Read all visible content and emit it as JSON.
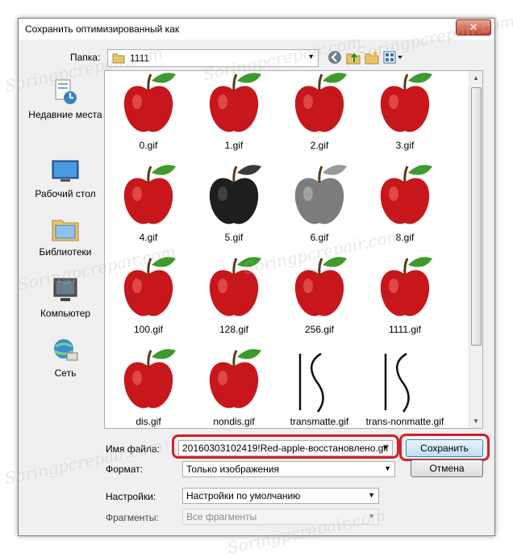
{
  "window": {
    "title": "Сохранить оптимизированный как",
    "close_glyph": "✕"
  },
  "toolbar": {
    "folder_label": "Папка:",
    "folder_value": "1111"
  },
  "places": [
    {
      "label": "Недавние места",
      "icon": "recent-places-icon"
    },
    {
      "label": "Рабочий стол",
      "icon": "desktop-icon"
    },
    {
      "label": "Библиотеки",
      "icon": "libraries-icon"
    },
    {
      "label": "Компьютер",
      "icon": "computer-icon"
    },
    {
      "label": "Сеть",
      "icon": "network-icon"
    }
  ],
  "files": [
    {
      "name": "0.gif",
      "kind": "apple"
    },
    {
      "name": "1.gif",
      "kind": "apple"
    },
    {
      "name": "2.gif",
      "kind": "apple"
    },
    {
      "name": "3.gif",
      "kind": "apple"
    },
    {
      "name": "4.gif",
      "kind": "apple"
    },
    {
      "name": "5.gif",
      "kind": "apple-dark"
    },
    {
      "name": "6.gif",
      "kind": "apple-gray"
    },
    {
      "name": "8.gif",
      "kind": "apple"
    },
    {
      "name": "100.gif",
      "kind": "apple"
    },
    {
      "name": "128.gif",
      "kind": "apple"
    },
    {
      "name": "256.gif",
      "kind": "apple"
    },
    {
      "name": "1111.gif",
      "kind": "apple"
    },
    {
      "name": "dis.gif",
      "kind": "apple"
    },
    {
      "name": "nondis.gif",
      "kind": "apple"
    },
    {
      "name": "transmatte.gif",
      "kind": "curve"
    },
    {
      "name": "trans-nonmatte.gif",
      "kind": "curve"
    }
  ],
  "form": {
    "filename_label": "Имя файла:",
    "filename_value": "20160303102419!Red-apple-восстановлено.gif",
    "format_label": "Формат:",
    "format_value": "Только изображения",
    "settings_label": "Настройки:",
    "settings_value": "Настройки по умолчанию",
    "fragments_label": "Фрагменты:",
    "fragments_value": "Все фрагменты"
  },
  "buttons": {
    "save": "Сохранить",
    "cancel": "Отмена"
  },
  "colors": {
    "highlight": "#d42027",
    "apple": "#c8161d",
    "leaf": "#3f9a2c"
  },
  "watermark_text": "Soringpcrepair.com"
}
